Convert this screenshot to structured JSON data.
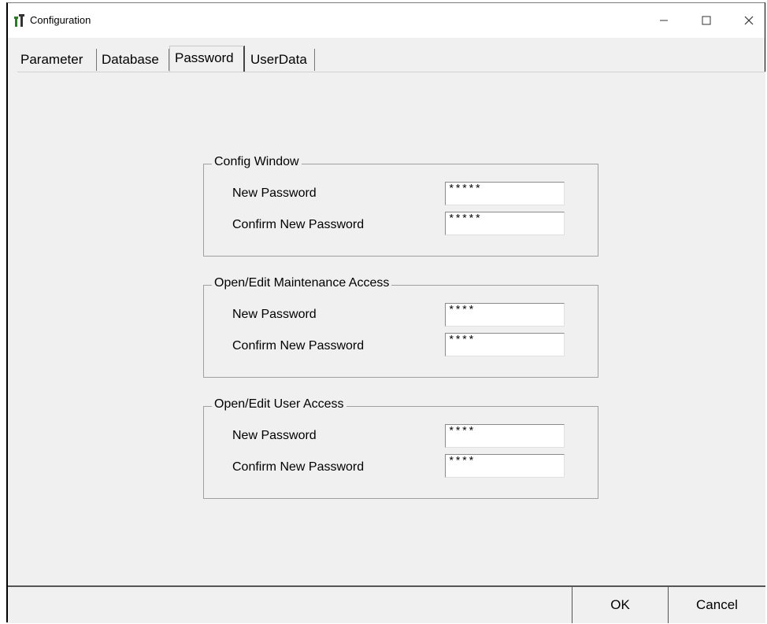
{
  "window": {
    "title": "Configuration",
    "icon": "tools-icon"
  },
  "tabs": [
    {
      "label": "Parameter",
      "active": false
    },
    {
      "label": "Database",
      "active": false
    },
    {
      "label": "Password",
      "active": true
    },
    {
      "label": "UserData",
      "active": false
    }
  ],
  "groups": [
    {
      "title": "Config Window",
      "new_password_label": "New Password",
      "new_password_value": "*****",
      "confirm_label": "Confirm New Password",
      "confirm_value": "*****"
    },
    {
      "title": "Open/Edit Maintenance Access",
      "new_password_label": "New Password",
      "new_password_value": "****",
      "confirm_label": "Confirm New Password",
      "confirm_value": "****"
    },
    {
      "title": "Open/Edit User Access",
      "new_password_label": "New Password",
      "new_password_value": "****",
      "confirm_label": "Confirm New Password",
      "confirm_value": "****"
    }
  ],
  "buttons": {
    "ok": "OK",
    "cancel": "Cancel"
  }
}
